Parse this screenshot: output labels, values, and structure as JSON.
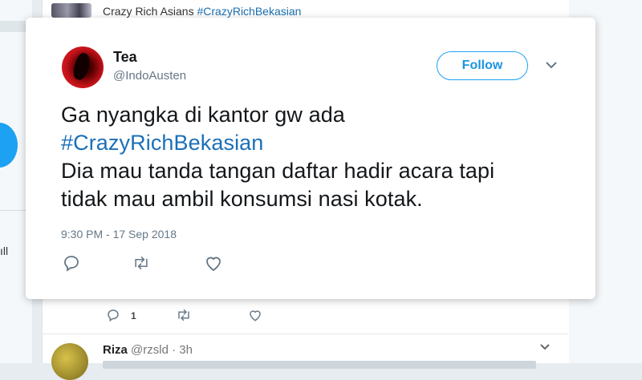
{
  "background": {
    "top_tweet": {
      "text": "Crazy Rich Asians ",
      "hashtag": "#CrazyRichBekasian"
    },
    "left_text": "ıll",
    "prev_tweet_actions": {
      "reply_count": "1"
    },
    "next_tweet": {
      "name": "Riza",
      "handle": "@rzsld",
      "time": "· 3h"
    }
  },
  "modal": {
    "user": {
      "name": "Tea",
      "handle": "@IndoAusten"
    },
    "follow_label": "Follow",
    "tweet": {
      "line1": "Ga nyangka di kantor gw ada",
      "hashtag": "#CrazyRichBekasian",
      "line3": "Dia mau tanda tangan daftar hadir acara tapi",
      "line4": "tidak mau ambil konsumsi nasi kotak."
    },
    "timestamp": "9:30 PM - 17 Sep 2018"
  },
  "colors": {
    "accent": "#1da1f2",
    "text": "#14171a",
    "muted": "#657786",
    "hashtag": "#1b6fb8"
  },
  "icons": [
    "reply-icon",
    "retweet-icon",
    "like-icon",
    "chevron-down-icon"
  ]
}
